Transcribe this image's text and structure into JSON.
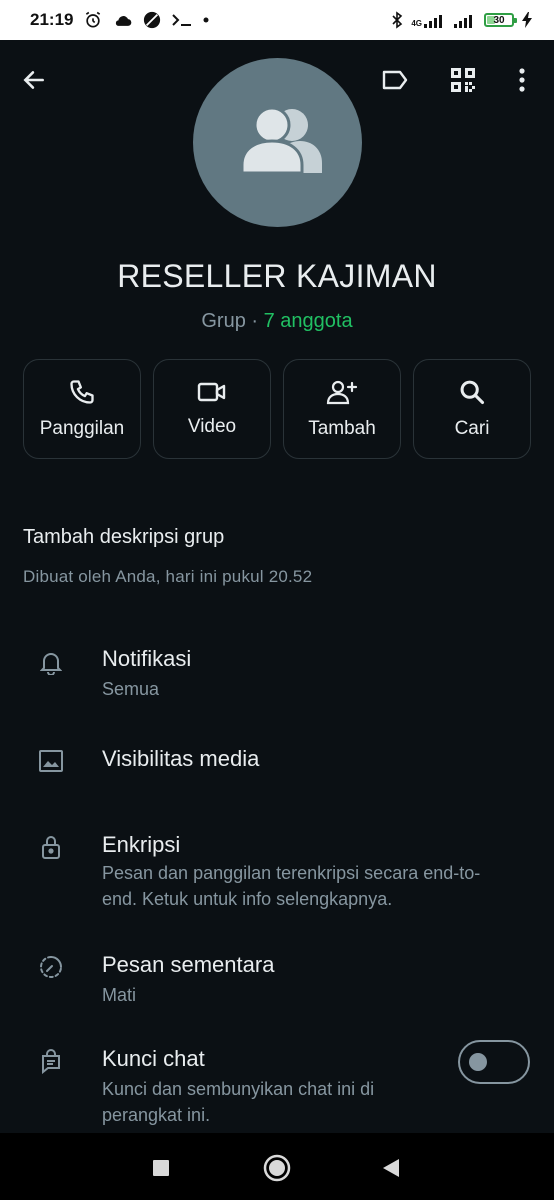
{
  "status_bar": {
    "time": "21:19",
    "network": "4G",
    "battery": "30"
  },
  "group": {
    "name": "RESELLER KAJIMAN",
    "type": "Grup",
    "separator": " · ",
    "members": "7 anggota"
  },
  "actions": [
    {
      "label": "Panggilan",
      "icon": "phone-icon"
    },
    {
      "label": "Video",
      "icon": "video-icon"
    },
    {
      "label": "Tambah",
      "icon": "add-person-icon"
    },
    {
      "label": "Cari",
      "icon": "search-icon"
    }
  ],
  "description": {
    "title": "Tambah deskripsi grup",
    "created": "Dibuat oleh Anda, hari ini pukul 20.52"
  },
  "settings": {
    "notifications": {
      "title": "Notifikasi",
      "sub": "Semua"
    },
    "media_visibility": {
      "title": "Visibilitas media"
    },
    "encryption": {
      "title": "Enkripsi",
      "sub": "Pesan dan panggilan terenkripsi secara end-to-end. Ketuk untuk info selengkapnya."
    },
    "disappearing": {
      "title": "Pesan sementara",
      "sub": "Mati"
    },
    "chat_lock": {
      "title": "Kunci chat",
      "sub": "Kunci dan sembunyikan chat ini di perangkat ini.",
      "enabled": false
    }
  },
  "colors": {
    "background": "#0b1014",
    "accent": "#21c063",
    "secondary_text": "#8696a0",
    "avatar_bg": "#617882"
  }
}
